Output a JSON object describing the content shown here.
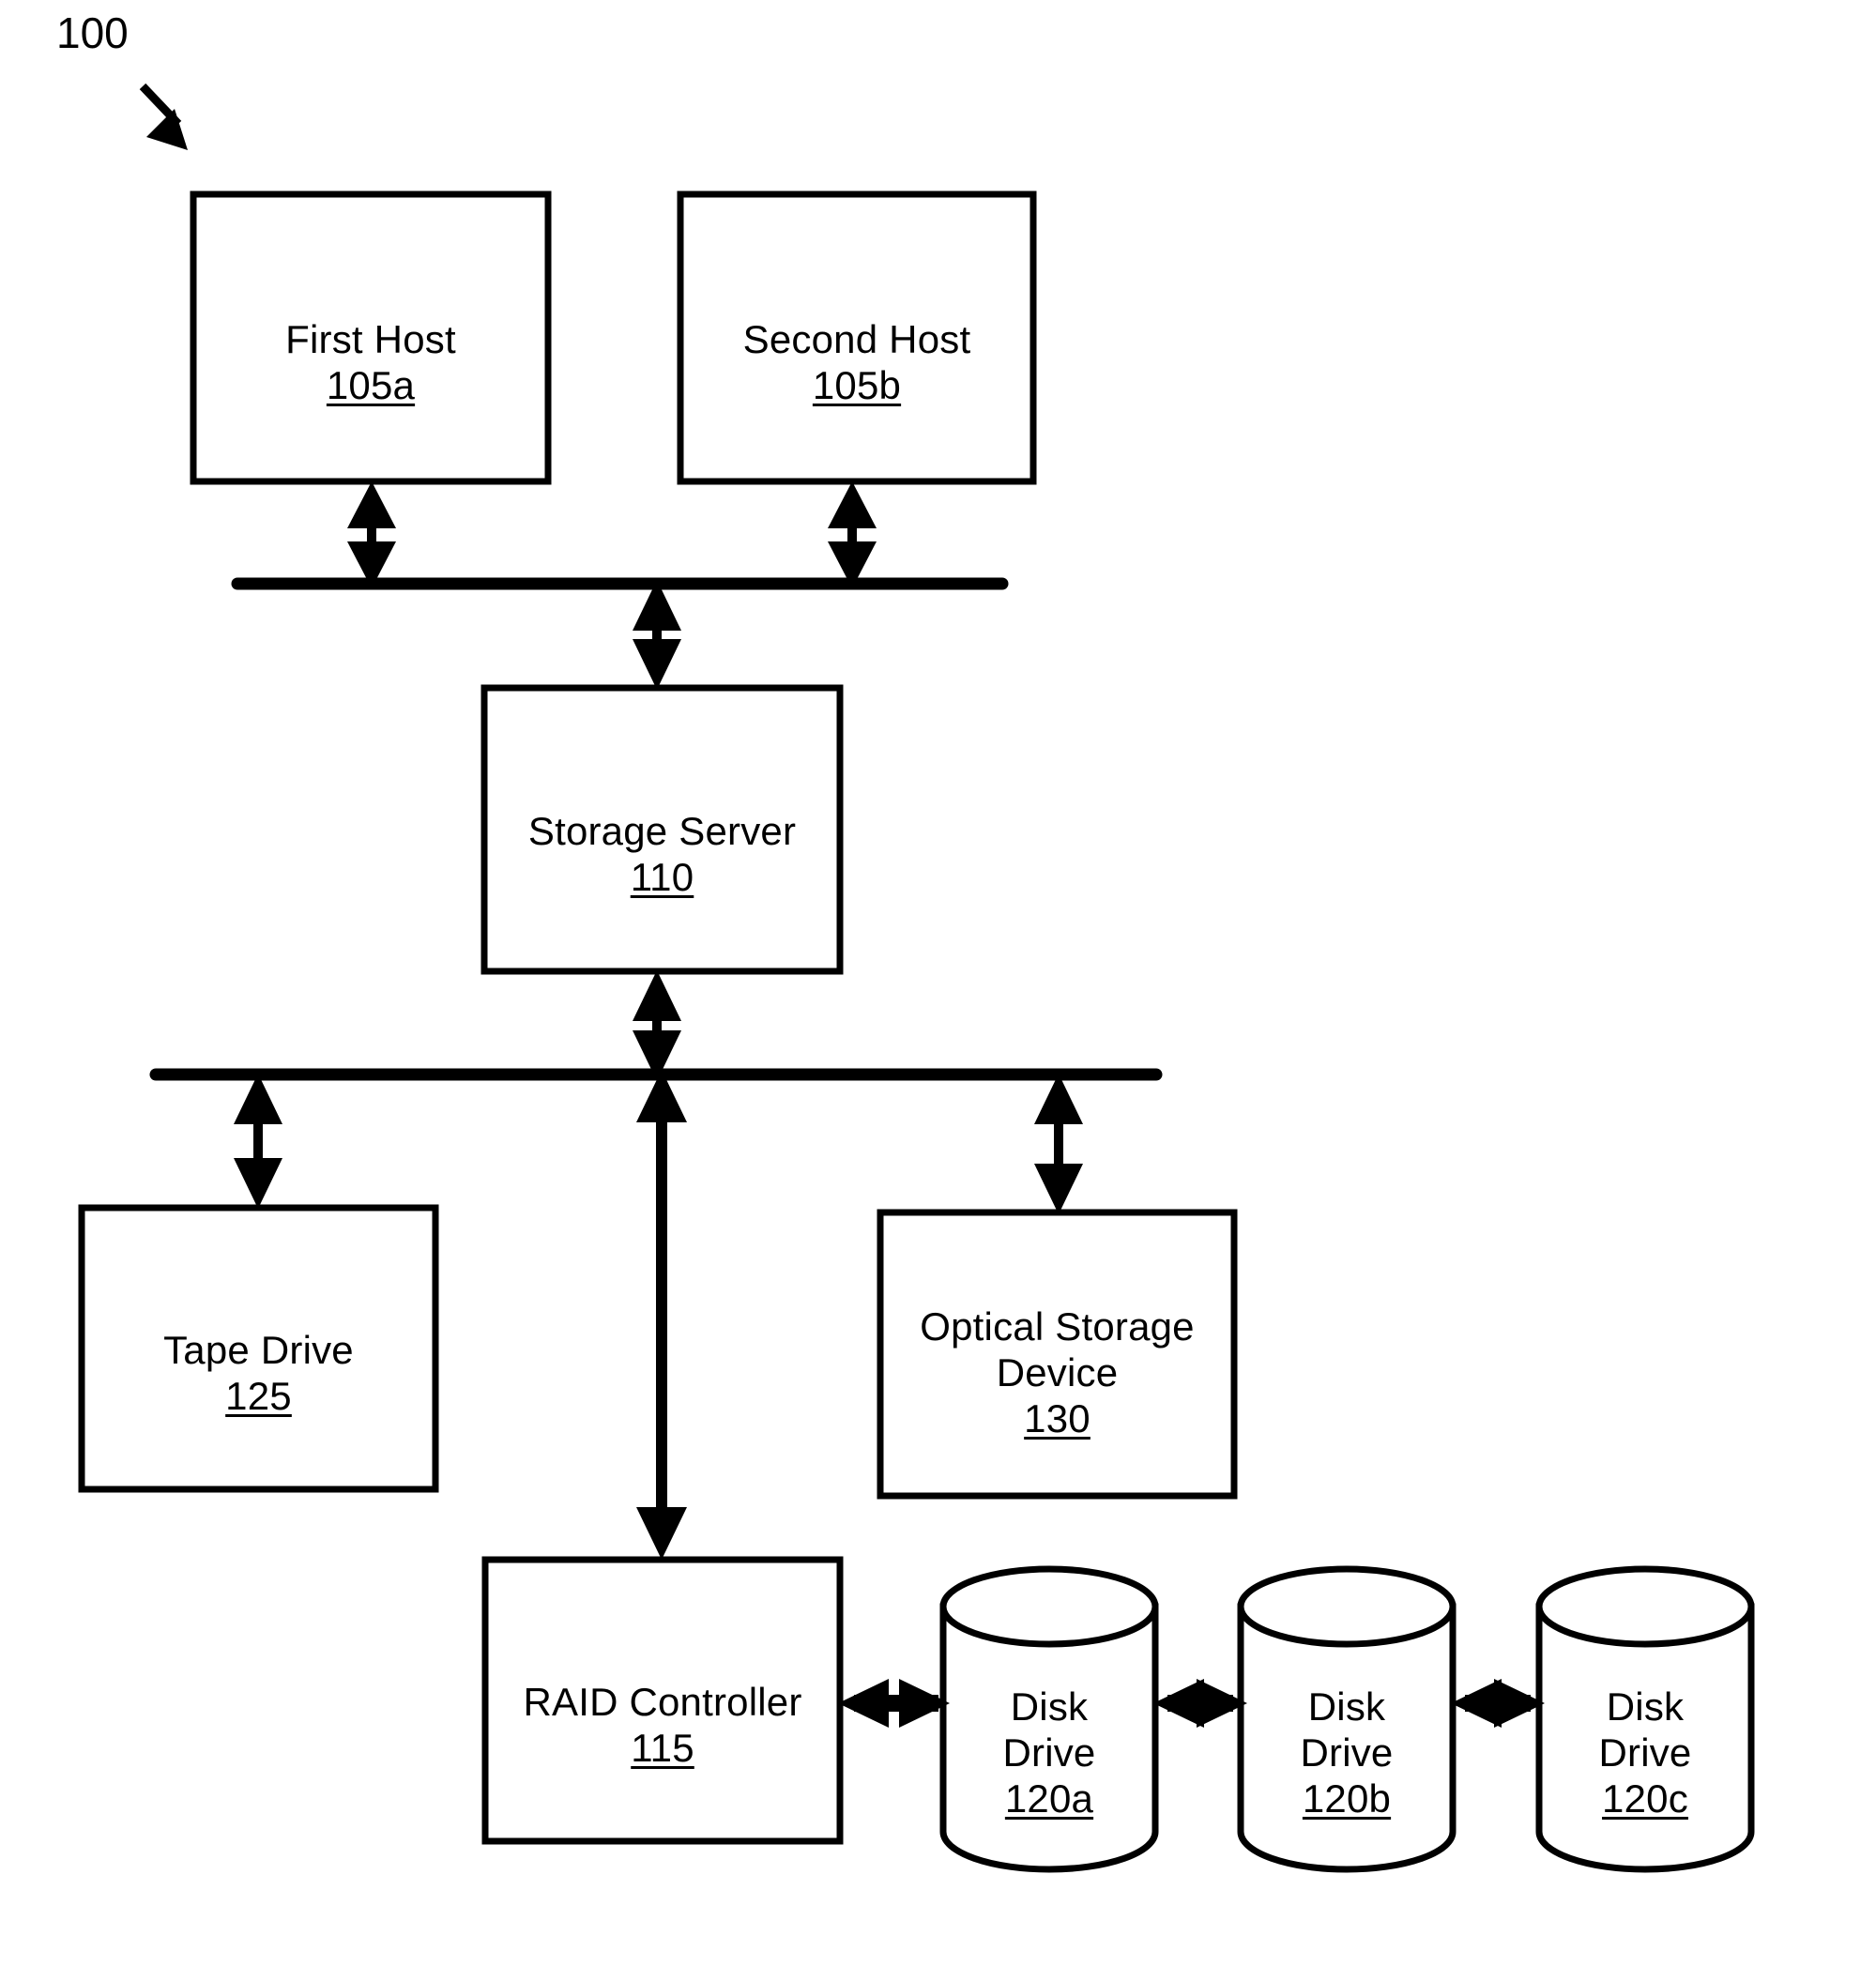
{
  "figure": {
    "figure_number": "100",
    "figure_number_icon": "diagonal-arrow-icon"
  },
  "nodes": {
    "first_host": {
      "title": "First Host",
      "ref": "105a",
      "shape": "rectangle"
    },
    "second_host": {
      "title": "Second Host",
      "ref": "105b",
      "shape": "rectangle"
    },
    "storage_server": {
      "title": "Storage Server",
      "ref": "110",
      "shape": "rectangle"
    },
    "tape_drive": {
      "title": "Tape Drive",
      "ref": "125",
      "shape": "rectangle"
    },
    "optical_storage_device": {
      "title": "Optical Storage\nDevice",
      "ref": "130",
      "shape": "rectangle"
    },
    "raid_controller": {
      "title": "RAID Controller",
      "ref": "115",
      "shape": "rectangle"
    },
    "disk_drive_a": {
      "title": "Disk\nDrive",
      "ref": "120a",
      "shape": "cylinder"
    },
    "disk_drive_b": {
      "title": "Disk\nDrive",
      "ref": "120b",
      "shape": "cylinder"
    },
    "disk_drive_c": {
      "title": "Disk\nDrive",
      "ref": "120c",
      "shape": "cylinder"
    }
  },
  "connectors": {
    "upper_bus": {
      "name": "upper-bus-line",
      "orientation": "horizontal"
    },
    "lower_bus": {
      "name": "lower-bus-line",
      "orientation": "horizontal"
    },
    "first_host_to_bus": {
      "name": "bidirectional-arrow",
      "orientation": "vertical"
    },
    "second_host_to_bus": {
      "name": "bidirectional-arrow",
      "orientation": "vertical"
    },
    "bus_to_storage_server": {
      "name": "bidirectional-arrow",
      "orientation": "vertical"
    },
    "storage_server_to_lower_bus": {
      "name": "bidirectional-arrow",
      "orientation": "vertical"
    },
    "lower_bus_to_tape_drive": {
      "name": "bidirectional-arrow",
      "orientation": "vertical"
    },
    "lower_bus_to_optical": {
      "name": "bidirectional-arrow",
      "orientation": "vertical"
    },
    "lower_bus_to_raid": {
      "name": "bidirectional-arrow",
      "orientation": "vertical"
    },
    "raid_to_disk_a": {
      "name": "bidirectional-arrow",
      "orientation": "horizontal"
    },
    "disk_a_to_disk_b": {
      "name": "bidirectional-arrow",
      "orientation": "horizontal"
    },
    "disk_b_to_disk_c": {
      "name": "bidirectional-arrow",
      "orientation": "horizontal"
    }
  },
  "style": {
    "stroke_color": "#000000",
    "fill_color": "#ffffff",
    "background": "#ffffff"
  }
}
